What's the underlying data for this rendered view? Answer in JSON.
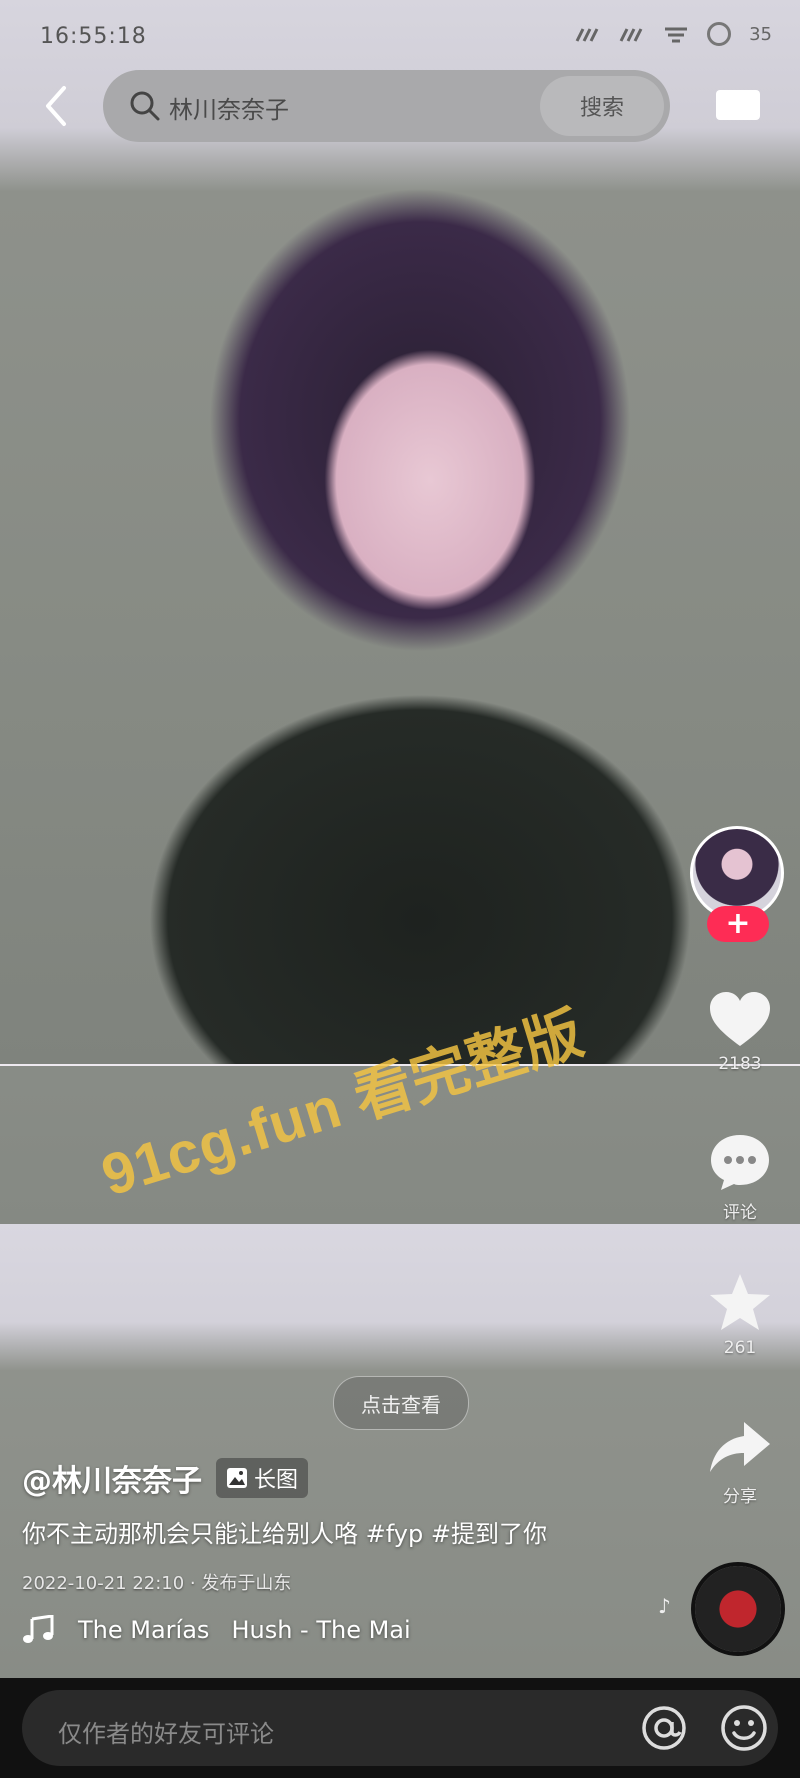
{
  "status_bar": {
    "time": "16:55:18",
    "battery": "35"
  },
  "search": {
    "query": "林川奈奈子",
    "button_label": "搜索"
  },
  "watermark": "91cg.fun 看完整版",
  "view_button_label": "点击查看",
  "rail": {
    "like_count": "2183",
    "comment_label": "评论",
    "favorite_count": "261",
    "share_label": "分享"
  },
  "post": {
    "author": "@林川奈奈子",
    "type_tag": "长图",
    "caption": "你不主动那机会只能让给别人咯 #fyp #提到了你",
    "meta": "2022-10-21 22:10 · 发布于山东",
    "music": {
      "artist": "The Marías",
      "song": "Hush - The Mai"
    }
  },
  "comment_bar": {
    "placeholder": "仅作者的好友可评论"
  },
  "colors": {
    "follow_accent": "#fe2c55",
    "watermark": "#f5c542"
  }
}
